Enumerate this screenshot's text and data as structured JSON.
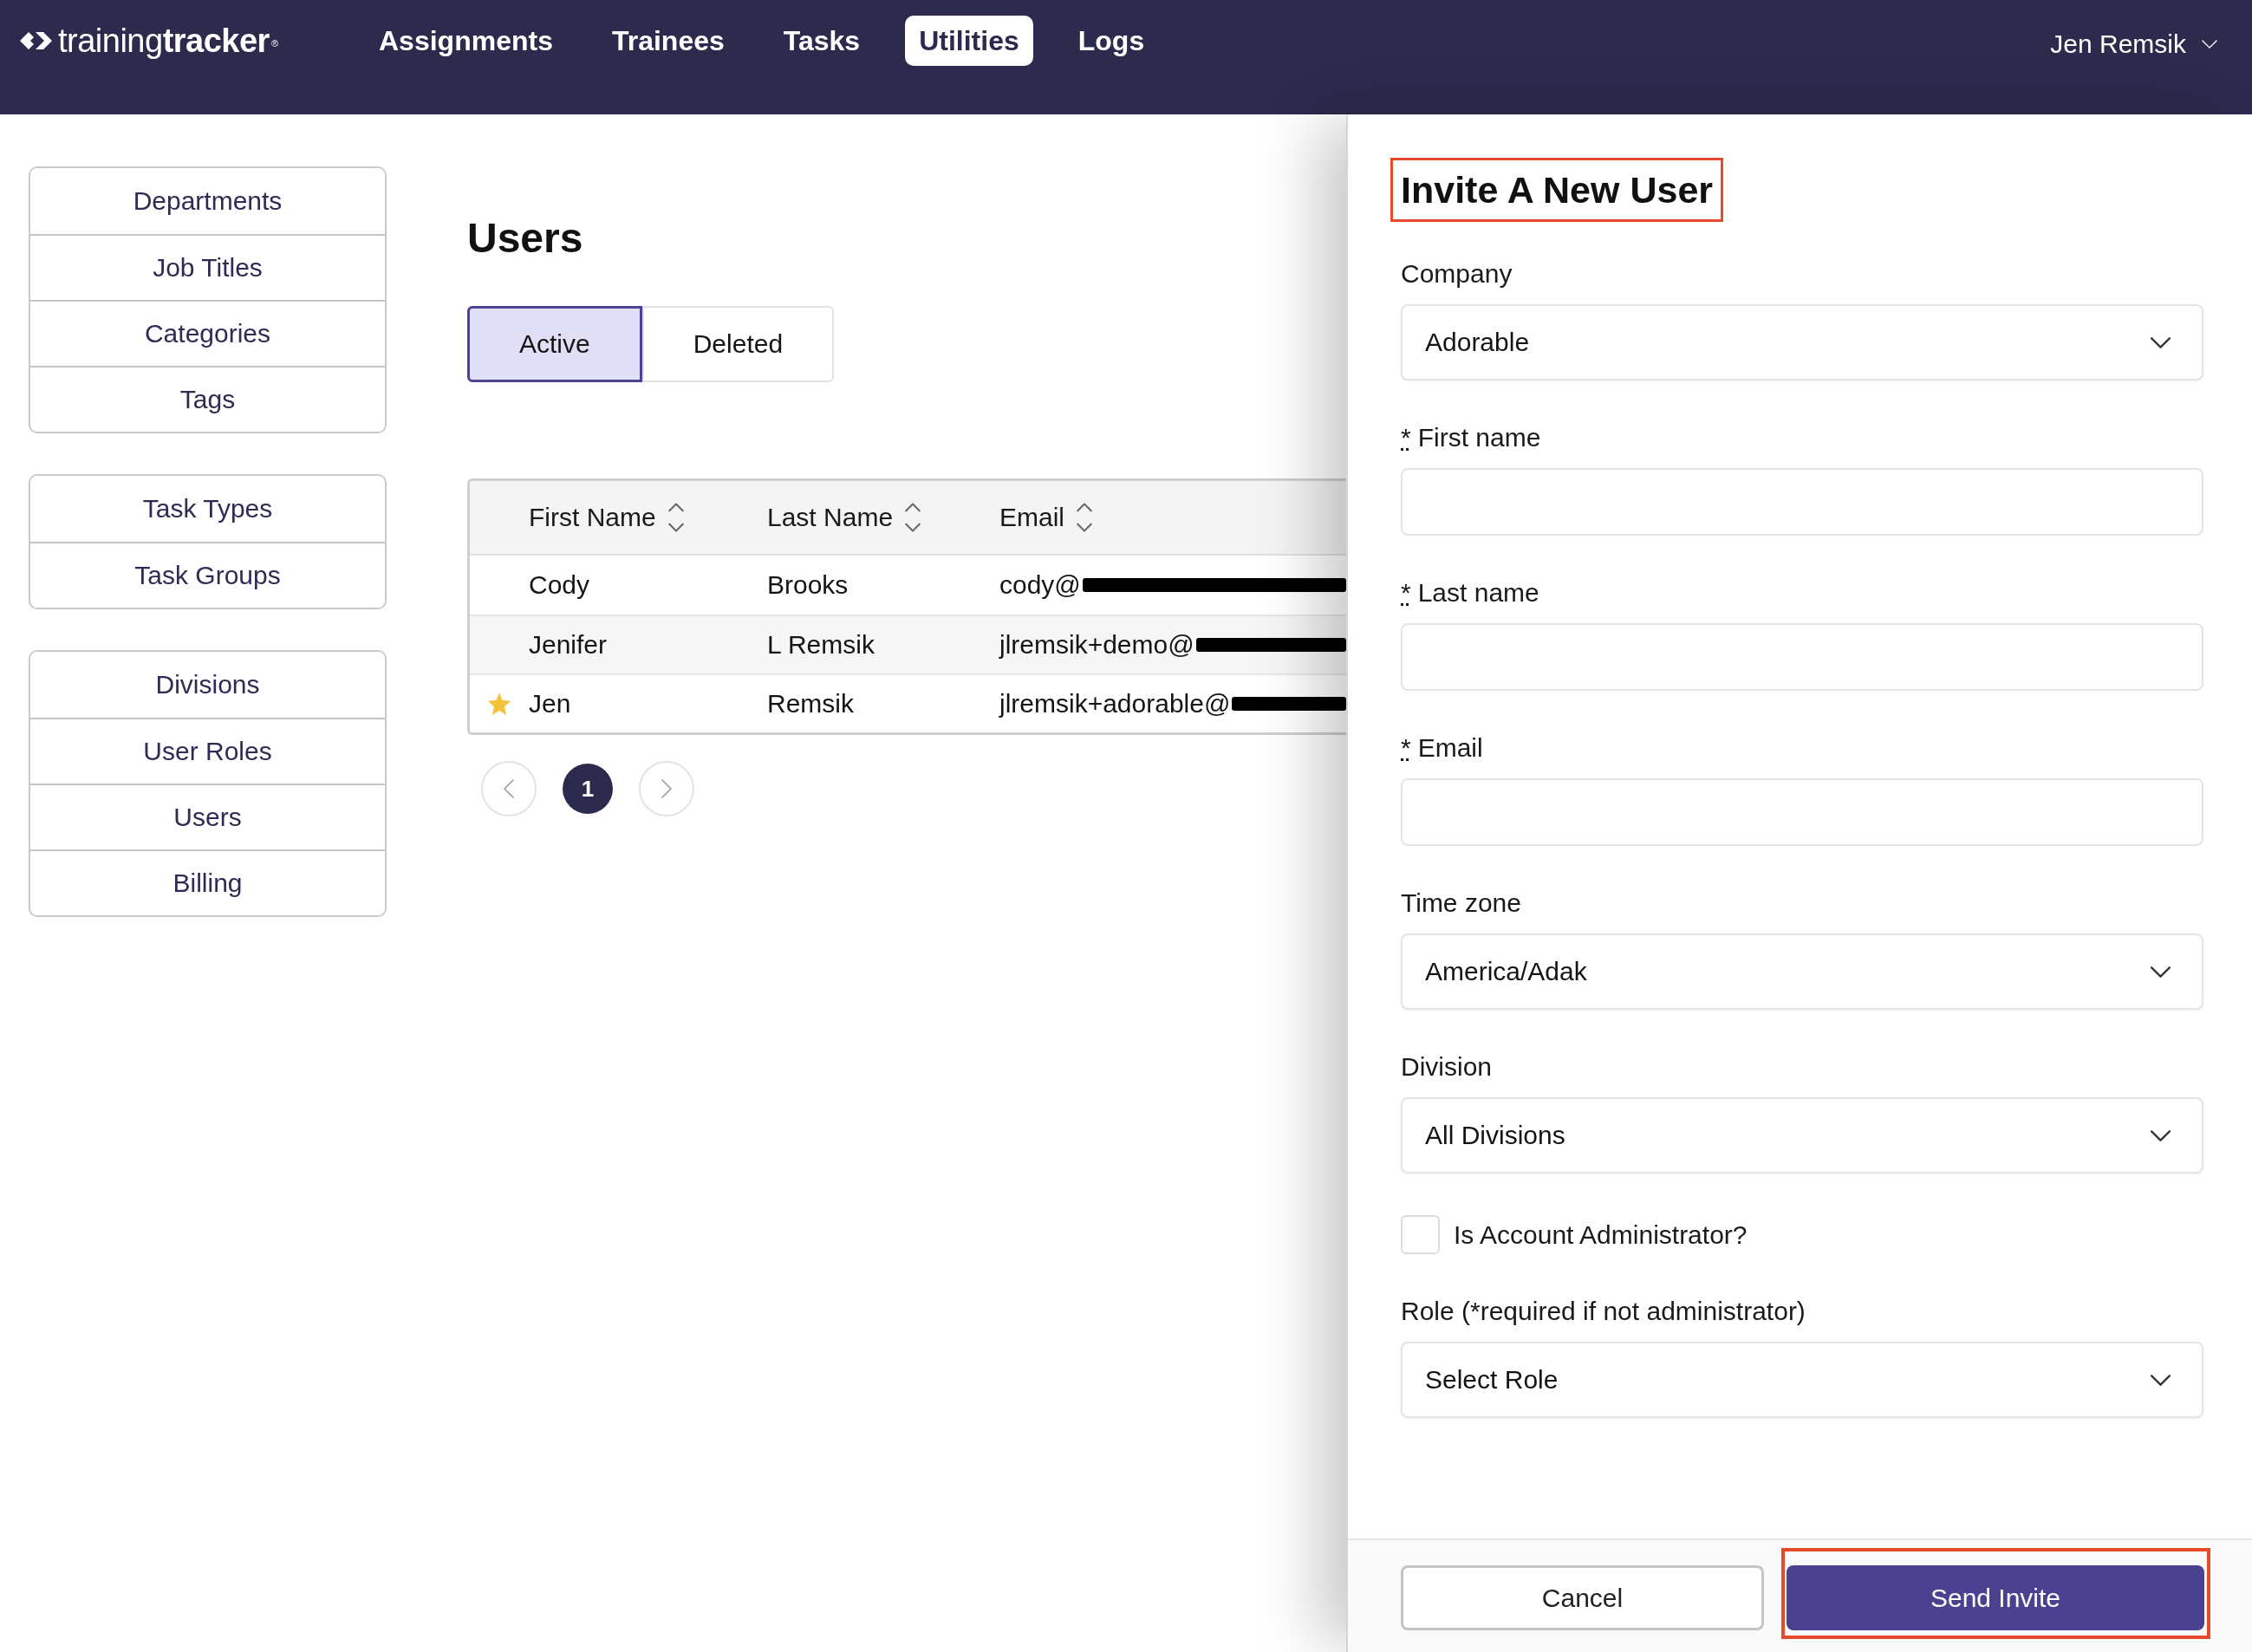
{
  "header": {
    "brand": "training**tracker**$^{®}$",
    "nav": [
      {
        "label": "Assignments",
        "selected": false
      },
      {
        "label": "Trainees",
        "selected": false
      },
      {
        "label": "Tasks",
        "selected": false
      },
      {
        "label": "Utilities",
        "selected": true
      },
      {
        "label": "Logs",
        "selected": false
      }
    ],
    "user_menu": "Jen Remsik"
  },
  "sidebar": {
    "groups": [
      {
        "items": [
          "Departments",
          "Job Titles",
          "Categories",
          "Tags"
        ]
      },
      {
        "items": [
          "Task Types",
          "Task Groups"
        ]
      },
      {
        "items": [
          "Divisions",
          "User Roles",
          "Users",
          "Billing"
        ]
      }
    ]
  },
  "users": {
    "title": "Users",
    "tabs": [
      {
        "label": "Active",
        "selected": true
      },
      {
        "label": "Deleted",
        "selected": false
      }
    ],
    "table": {
      "columns": [
        {
          "label": "First Name",
          "sortable": true
        },
        {
          "label": "Last Name",
          "sortable": true
        },
        {
          "label": "Email",
          "sortable": true
        }
      ],
      "rows": [
        {
          "starred": false,
          "first_name": "Cody",
          "last_name": "Brooks",
          "email": "cody@",
          "email_redacted": true
        },
        {
          "starred": false,
          "first_name": "Jenifer",
          "last_name": "L Remsik",
          "email": "jlremsik+demo@",
          "email_redacted": true
        },
        {
          "starred": true,
          "first_name": "Jen",
          "last_name": "Remsik",
          "email": "jlremsik+adorable@",
          "email_redacted": true
        }
      ]
    },
    "pagination": {
      "pages": [
        {
          "label": "1",
          "selected": true
        }
      ]
    }
  },
  "invite_panel": {
    "title": {
      "text": "Invite A New User",
      "highlighted": true
    },
    "fields": [
      {
        "kind": "select",
        "label": "Company",
        "value": "Adorable"
      },
      {
        "kind": "text",
        "required_mark": "*",
        "label": "First name"
      },
      {
        "kind": "text",
        "required_mark": "*",
        "label": "Last name"
      },
      {
        "kind": "text",
        "required_mark": "*",
        "label": "Email"
      },
      {
        "kind": "select",
        "label": "Time zone",
        "value": "America/Adak"
      },
      {
        "kind": "select",
        "label": "Division",
        "value": "All Divisions"
      },
      {
        "kind": "checkbox",
        "label": "Is Account Administrator?",
        "checked": false
      },
      {
        "kind": "select",
        "label": "Role (*required if not administrator)",
        "value": "Select Role"
      }
    ],
    "buttons": [
      {
        "kind": "secondary",
        "label": "Cancel",
        "highlighted": false
      },
      {
        "kind": "primary",
        "label": "Send Invite",
        "highlighted": true
      }
    ]
  }
}
